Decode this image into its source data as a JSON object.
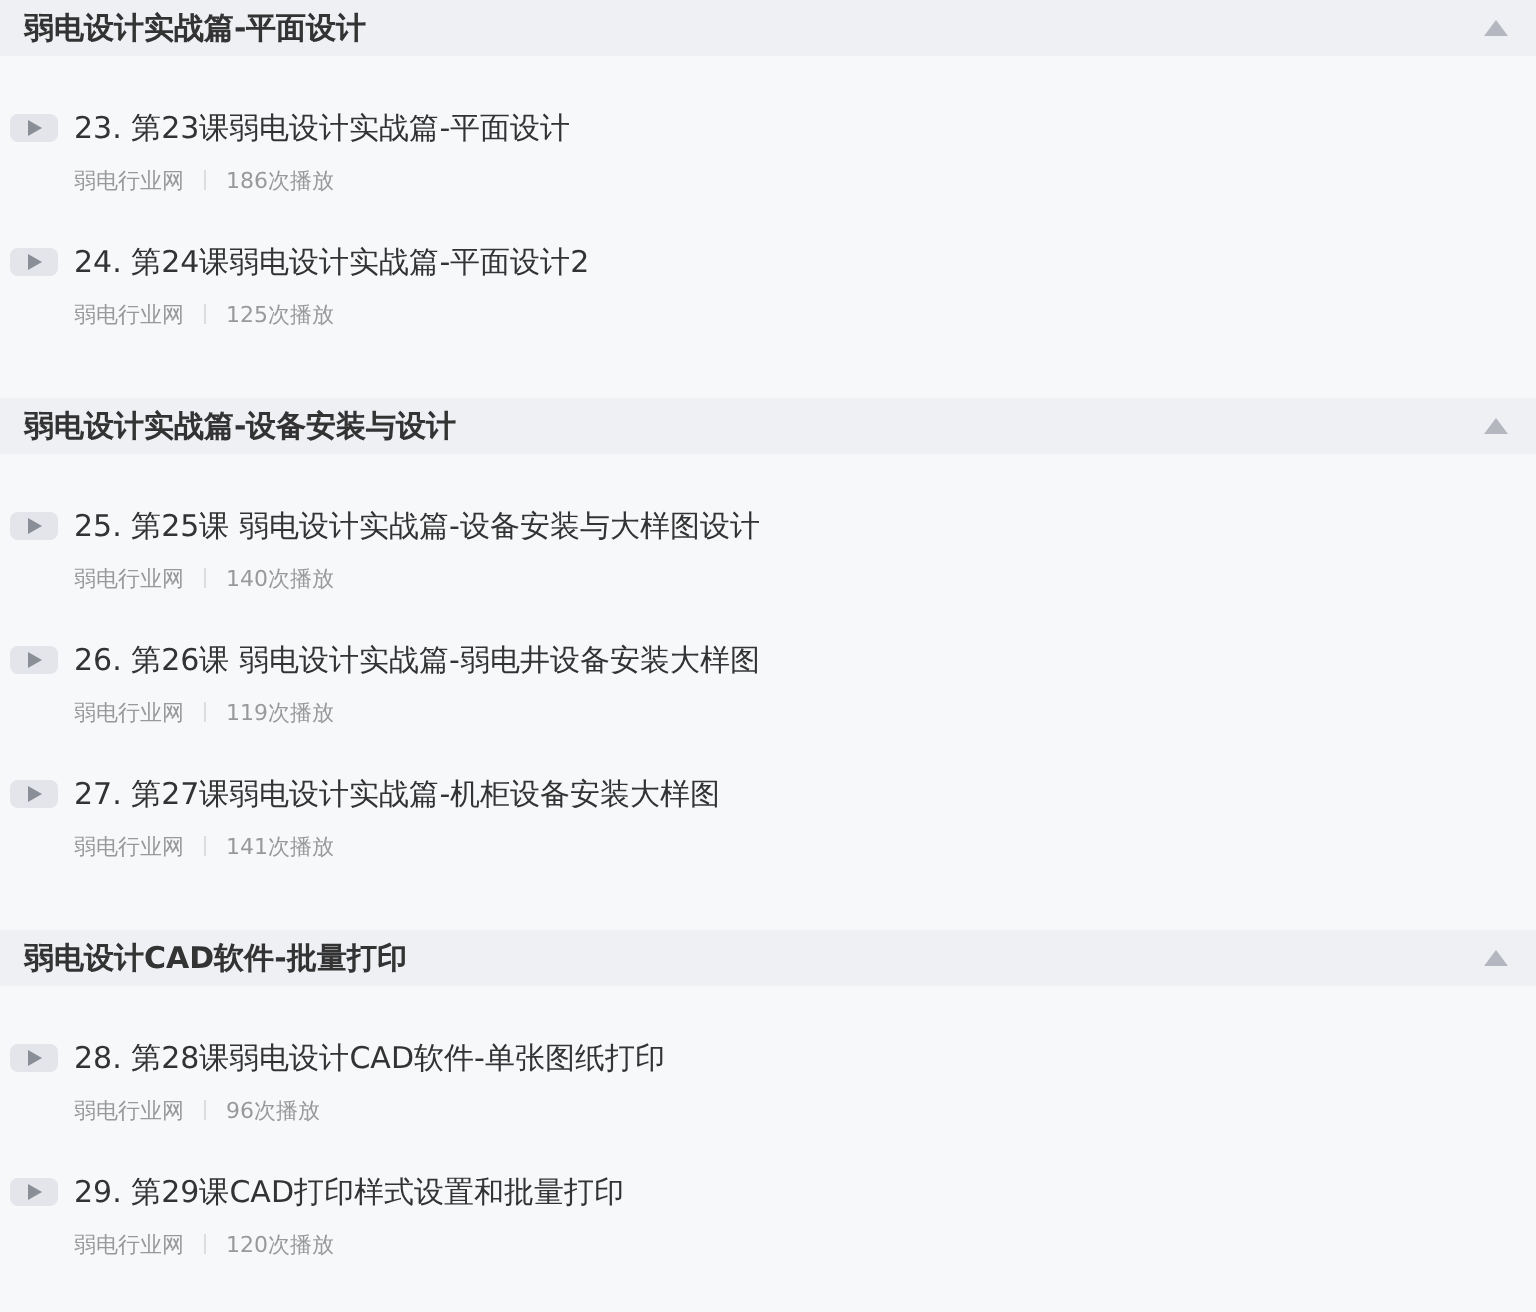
{
  "sections": [
    {
      "title": "弱电设计实战篇-平面设计",
      "expanded": true,
      "lessons": [
        {
          "title": "23. 第23课弱电设计实战篇-平面设计",
          "source": "弱电行业网",
          "plays": "186次播放"
        },
        {
          "title": "24. 第24课弱电设计实战篇-平面设计2",
          "source": "弱电行业网",
          "plays": "125次播放"
        }
      ]
    },
    {
      "title": "弱电设计实战篇-设备安装与设计",
      "expanded": true,
      "lessons": [
        {
          "title": "25. 第25课 弱电设计实战篇-设备安装与大样图设计",
          "source": "弱电行业网",
          "plays": "140次播放"
        },
        {
          "title": "26. 第26课 弱电设计实战篇-弱电井设备安装大样图",
          "source": "弱电行业网",
          "plays": "119次播放"
        },
        {
          "title": "27. 第27课弱电设计实战篇-机柜设备安装大样图",
          "source": "弱电行业网",
          "plays": "141次播放"
        }
      ]
    },
    {
      "title": "弱电设计CAD软件-批量打印",
      "expanded": true,
      "lessons": [
        {
          "title": "28. 第28课弱电设计CAD软件-单张图纸打印",
          "source": "弱电行业网",
          "plays": "96次播放"
        },
        {
          "title": "29. 第29课CAD打印样式设置和批量打印",
          "source": "弱电行业网",
          "plays": "120次播放"
        }
      ]
    }
  ]
}
